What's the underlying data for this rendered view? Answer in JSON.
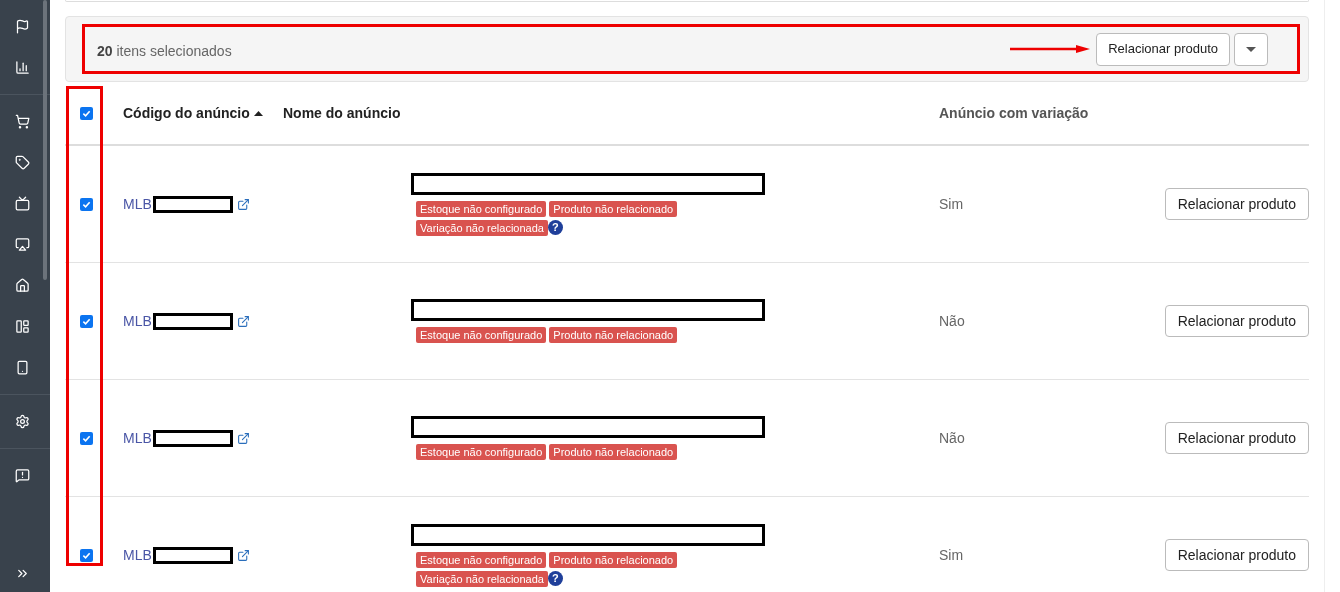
{
  "bulk_bar": {
    "count": "20",
    "label": "itens selecionados",
    "action": "Relacionar produto"
  },
  "table": {
    "select_all_checked": true,
    "columns": [
      {
        "label": "Código do anúncio",
        "sort_ascending": true
      },
      {
        "label": "Nome do anúncio"
      },
      {
        "label": "Anúncio com variação"
      }
    ],
    "rows": [
      {
        "checked": true,
        "code": "MLB",
        "tags": [
          "Estoque não configurado",
          "Produto não relacionado",
          "Variação não relacionada"
        ],
        "help_icon": "?",
        "variation": "Sim",
        "action": "Relacionar produto"
      },
      {
        "checked": true,
        "code": "MLB",
        "tags": [
          "Estoque não configurado",
          "Produto não relacionado"
        ],
        "variation": "Não",
        "action": "Relacionar produto"
      },
      {
        "checked": true,
        "code": "MLB",
        "tags": [
          "Estoque não configurado",
          "Produto não relacionado"
        ],
        "variation": "Não",
        "action": "Relacionar produto"
      },
      {
        "checked": true,
        "code": "MLB",
        "tags": [
          "Estoque não configurado",
          "Produto não relacionado",
          "Variação não relacionada"
        ],
        "help_icon": "?",
        "variation": "Sim",
        "action": "Relacionar produto"
      }
    ]
  }
}
